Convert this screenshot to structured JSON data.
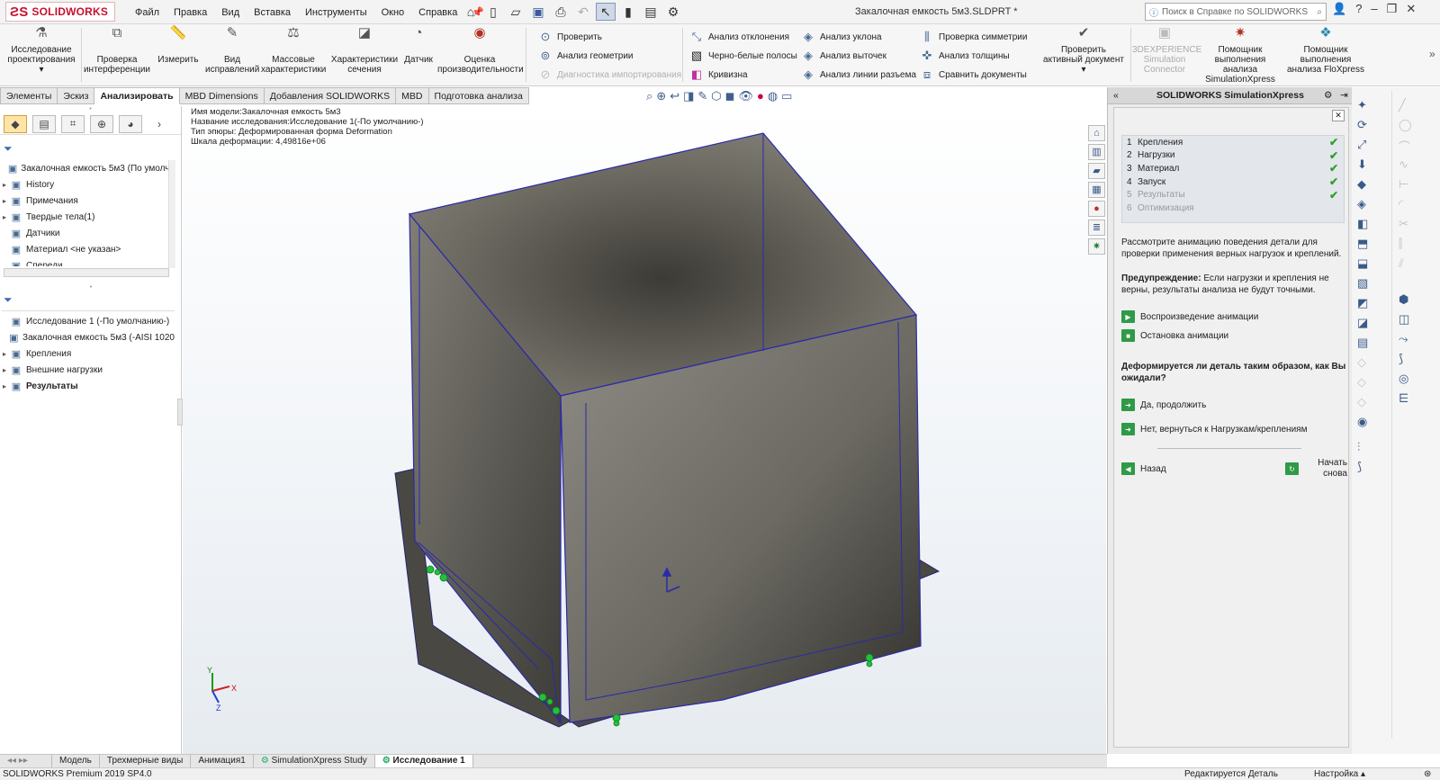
{
  "app": {
    "logo_text": "SOLIDWORKS",
    "document_title": "Закалочная емкость 5м3.SLDPRT *"
  },
  "menu": [
    "Файл",
    "Правка",
    "Вид",
    "Вставка",
    "Инструменты",
    "Окно",
    "Справка"
  ],
  "help_search": {
    "placeholder": "Поиск в Справке по SOLIDWORKS"
  },
  "ribbon": {
    "big_buttons": [
      {
        "label1": "Исследование",
        "label2": "проектирования",
        "icon": "design-study-icon"
      },
      {
        "label1": "Проверка",
        "label2": "интерференции",
        "icon": "interference-icon"
      },
      {
        "label1": "Измерить",
        "label2": "",
        "icon": "measure-icon"
      },
      {
        "label1": "Вид",
        "label2": "исправлений",
        "icon": "revision-view-icon"
      },
      {
        "label1": "Массовые",
        "label2": "характеристики",
        "icon": "mass-properties-icon"
      },
      {
        "label1": "Характеристики",
        "label2": "сечения",
        "icon": "section-properties-icon"
      },
      {
        "label1": "Датчик",
        "label2": "",
        "icon": "sensor-icon"
      },
      {
        "label1": "Оценка",
        "label2": "производительности",
        "icon": "performance-icon"
      }
    ],
    "check_group": [
      "Проверить",
      "Анализ геометрии",
      "Диагностика импортирования"
    ],
    "analysis_group1": [
      "Анализ отклонения",
      "Черно-белые полосы",
      "Кривизна"
    ],
    "analysis_group2": [
      "Анализ уклона",
      "Анализ выточек",
      "Анализ линии разъема"
    ],
    "analysis_group3": [
      "Проверка симметрии",
      "Анализ толщины",
      "Сравнить документы"
    ],
    "check_active": {
      "label1": "Проверить",
      "label2": "активный документ"
    },
    "experience": {
      "label1": "3DEXPERIENCE",
      "label2": "Simulation",
      "label3": "Connector"
    },
    "simxpress": {
      "label1": "Помощник",
      "label2": "выполнения анализа",
      "label3": "SimulationXpress"
    },
    "floxpress": {
      "label1": "Помощник",
      "label2": "выполнения",
      "label3": "анализа FloXpress"
    }
  },
  "tabs": [
    "Элементы",
    "Эскиз",
    "Анализировать",
    "MBD Dimensions",
    "Добавления SOLIDWORKS",
    "MBD",
    "Подготовка анализа"
  ],
  "feature_tree": [
    {
      "label": "Закалочная емкость 5м3  (По умолча",
      "icon": "part-icon",
      "arrow": ""
    },
    {
      "label": "History",
      "icon": "history-icon",
      "arrow": "▸"
    },
    {
      "label": "Примечания",
      "icon": "annotations-icon",
      "arrow": "▸"
    },
    {
      "label": "Твердые тела(1)",
      "icon": "solid-bodies-icon",
      "arrow": "▸"
    },
    {
      "label": "Датчики",
      "icon": "sensors-icon",
      "arrow": ""
    },
    {
      "label": "Материал <не указан>",
      "icon": "material-icon",
      "arrow": ""
    },
    {
      "label": "Спереди",
      "icon": "plane-icon",
      "arrow": ""
    }
  ],
  "study_tree": [
    {
      "label": "Исследование 1 (-По умолчанию-)",
      "icon": "study-icon",
      "arrow": ""
    },
    {
      "label": "Закалочная емкость 5м3 (-AISI 1020",
      "icon": "part-material-icon",
      "arrow": ""
    },
    {
      "label": "Крепления",
      "icon": "fixtures-icon",
      "arrow": "▸"
    },
    {
      "label": "Внешние нагрузки",
      "icon": "external-loads-icon",
      "arrow": "▸"
    },
    {
      "label": "Результаты",
      "icon": "results-icon",
      "arrow": "▸"
    }
  ],
  "viewport_info": [
    "Имя модели:Закалочная емкость 5м3",
    "Название исследования:Исследование 1(-По умолчанию-)",
    "Тип эпюры: Деформированная форма Deformation",
    "Шкала деформации: 4,49816e+06"
  ],
  "simxpress_panel": {
    "title": "SOLIDWORKS SimulationXpress",
    "steps": [
      {
        "num": "1",
        "label": "Крепления",
        "done": true
      },
      {
        "num": "2",
        "label": "Нагрузки",
        "done": true
      },
      {
        "num": "3",
        "label": "Материал",
        "done": true
      },
      {
        "num": "4",
        "label": "Запуск",
        "done": true
      },
      {
        "num": "5",
        "label": "Результаты",
        "done": true
      },
      {
        "num": "6",
        "label": "Оптимизация",
        "done": false
      }
    ],
    "instruction": "Рассмотрите анимацию поведения детали для проверки применения верных нагрузок и креплений.",
    "warning_label": "Предупреждение:",
    "warning_text": " Если нагрузки и крепления не верны, результаты анализа не будут точными.",
    "play_animation": "Воспроизведение анимации",
    "stop_animation": "Остановка анимации",
    "question": "Деформируется ли деталь таким образом, как Вы ожидали?",
    "yes": "Да, продолжить",
    "no": "Нет, вернуться к Нагрузкам/креплениям",
    "back": "Назад",
    "restart1": "Начать",
    "restart2": "снова"
  },
  "bottom_tabs": [
    "Модель",
    "Трехмерные виды",
    "Анимация1",
    "SimulationXpress Study",
    "Исследование 1"
  ],
  "status": {
    "version": "SOLIDWORKS Premium 2019 SP4.0",
    "mode": "Редактируется Деталь",
    "settings": "Настройка"
  },
  "triad": {
    "x": "X",
    "y": "Y",
    "z": "Z"
  },
  "colors": {
    "model_face": "#58554d",
    "model_edge": "#2a2aa8",
    "fixture": "#1fc23a",
    "check": "#2fa02f"
  }
}
